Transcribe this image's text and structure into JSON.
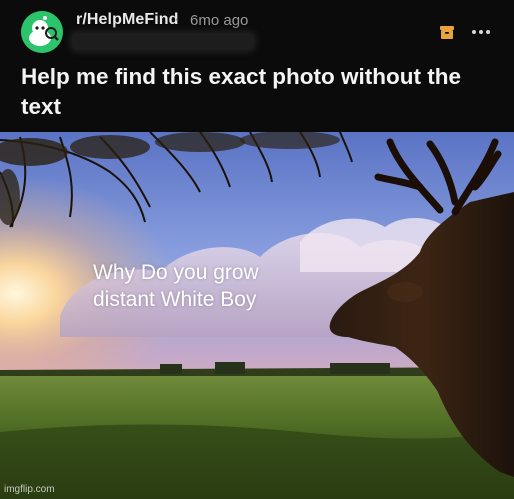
{
  "post": {
    "subreddit": "r/HelpMeFind",
    "separator": "·",
    "age": "6mo ago",
    "title": "Help me find this exact photo without the text"
  },
  "meme": {
    "line1": "Why Do you grow",
    "line2": "distant White Boy"
  },
  "watermark": "imgflip.com",
  "icons": {
    "archive": "archive-icon",
    "more": "more-options-icon",
    "avatar": "subreddit-avatar-icon"
  },
  "colors": {
    "accent_archive": "#e8a33c",
    "avatar_bg": "#2bc36b",
    "text_primary": "#f4f4f4",
    "text_meta": "#9a9a9a",
    "background": "#0b0b0b"
  }
}
